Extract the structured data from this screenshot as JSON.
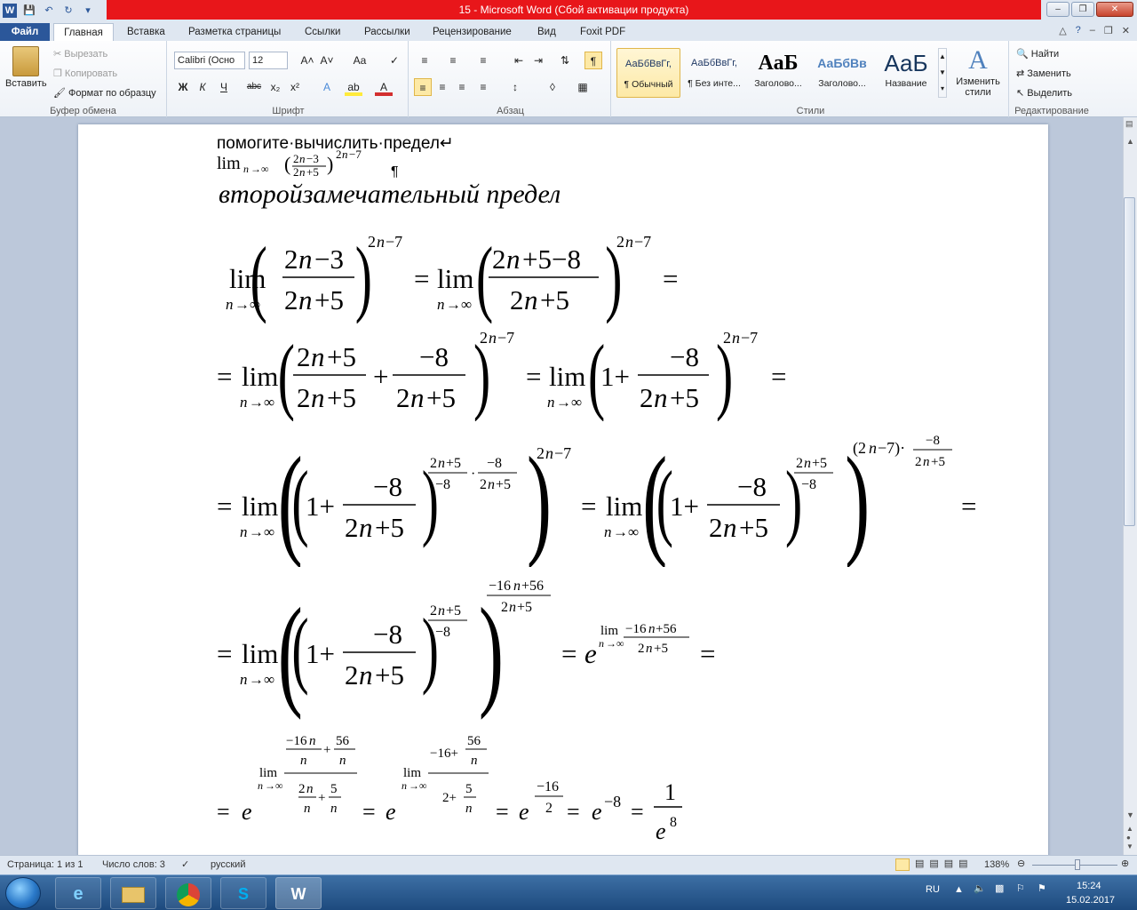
{
  "titlebar": {
    "title": "15  -  Microsoft Word (Сбой активации продукта)"
  },
  "tabs": [
    "Файл",
    "Главная",
    "Вставка",
    "Разметка страницы",
    "Ссылки",
    "Рассылки",
    "Рецензирование",
    "Вид",
    "Foxit PDF"
  ],
  "ribbon": {
    "clipboard": {
      "paste": "Вставить",
      "cut": "Вырезать",
      "copy": "Копировать",
      "format_painter": "Формат по образцу",
      "label": "Буфер обмена"
    },
    "font": {
      "name": "Calibri (Осно",
      "size": "12",
      "label": "Шрифт"
    },
    "paragraph": {
      "label": "Абзац"
    },
    "styles": {
      "items": [
        {
          "preview": "АаБбВвГг,",
          "name": "¶ Обычный"
        },
        {
          "preview": "АаБбВвГг,",
          "name": "¶ Без инте..."
        },
        {
          "preview": "АаБ",
          "name": "Заголово..."
        },
        {
          "preview": "АаБбВв",
          "name": "Заголово..."
        },
        {
          "preview": "АаБ",
          "name": "Название"
        }
      ],
      "change": "Изменить стили",
      "label": "Стили"
    },
    "editing": {
      "find": "Найти",
      "replace": "Заменить",
      "select": "Выделить",
      "label": "Редактирование"
    }
  },
  "document": {
    "line1": "помогите·вычислить·предел↵",
    "heading": "второйзамечательный предел"
  },
  "status": {
    "page": "Страница: 1 из 1",
    "words": "Число слов: 3",
    "lang": "русский",
    "zoom": "138%"
  },
  "tray": {
    "lang": "RU",
    "time": "15:24",
    "date": "15.02.2017"
  }
}
